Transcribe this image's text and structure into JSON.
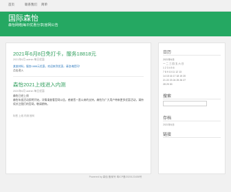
{
  "nav": {
    "items": [
      "首页",
      "联系我们",
      "简单"
    ]
  },
  "site": {
    "title": "国际森怡",
    "description": "森怡网络|每日优惠分享|官网公告"
  },
  "posts": [
    {
      "title": "2021年6月8日免打卡，服务18818元",
      "meta": "2021年6月 admin 每日优惠",
      "excerpt_1": "某某材料，服务1688元优惠，欢迎来到优惠，请咨询提问！",
      "excerpt_2": "点击进入",
      "tag": "标签 优惠 活动"
    },
    {
      "title": "森怡2021上线进入内测",
      "meta": "2020年6月 admin 每日优惠",
      "excerpt_1": "森怡已经上线",
      "excerpt_2": "森怡年度活动即将开始，详情请查看官网公告，感谢您一直以来的支持。森怡为广大用户带来更多优惠活动，请持续关注我们的官网，敬请期待。",
      "tag": "标签 上线 内测 官网"
    }
  ],
  "sidebar": {
    "calendar_title": "日历",
    "calendar_month": "2021年6月",
    "calendar_head": "一 二 三 四 五 六 日",
    "calendar_rows": [
      "1 2 3 4 5 6",
      "7 8 9 10 11 12 13",
      "14 15 16 17 18 19 20",
      "21 22 23 24 25 26 27",
      "28 29 30"
    ],
    "search_title": "搜索",
    "archive_title": "存档",
    "archive_item": "2021年6月",
    "links_title": "链接"
  },
  "footer": {
    "text": "Powered by 森怡 备案号 粤ICP备2020123456号"
  }
}
